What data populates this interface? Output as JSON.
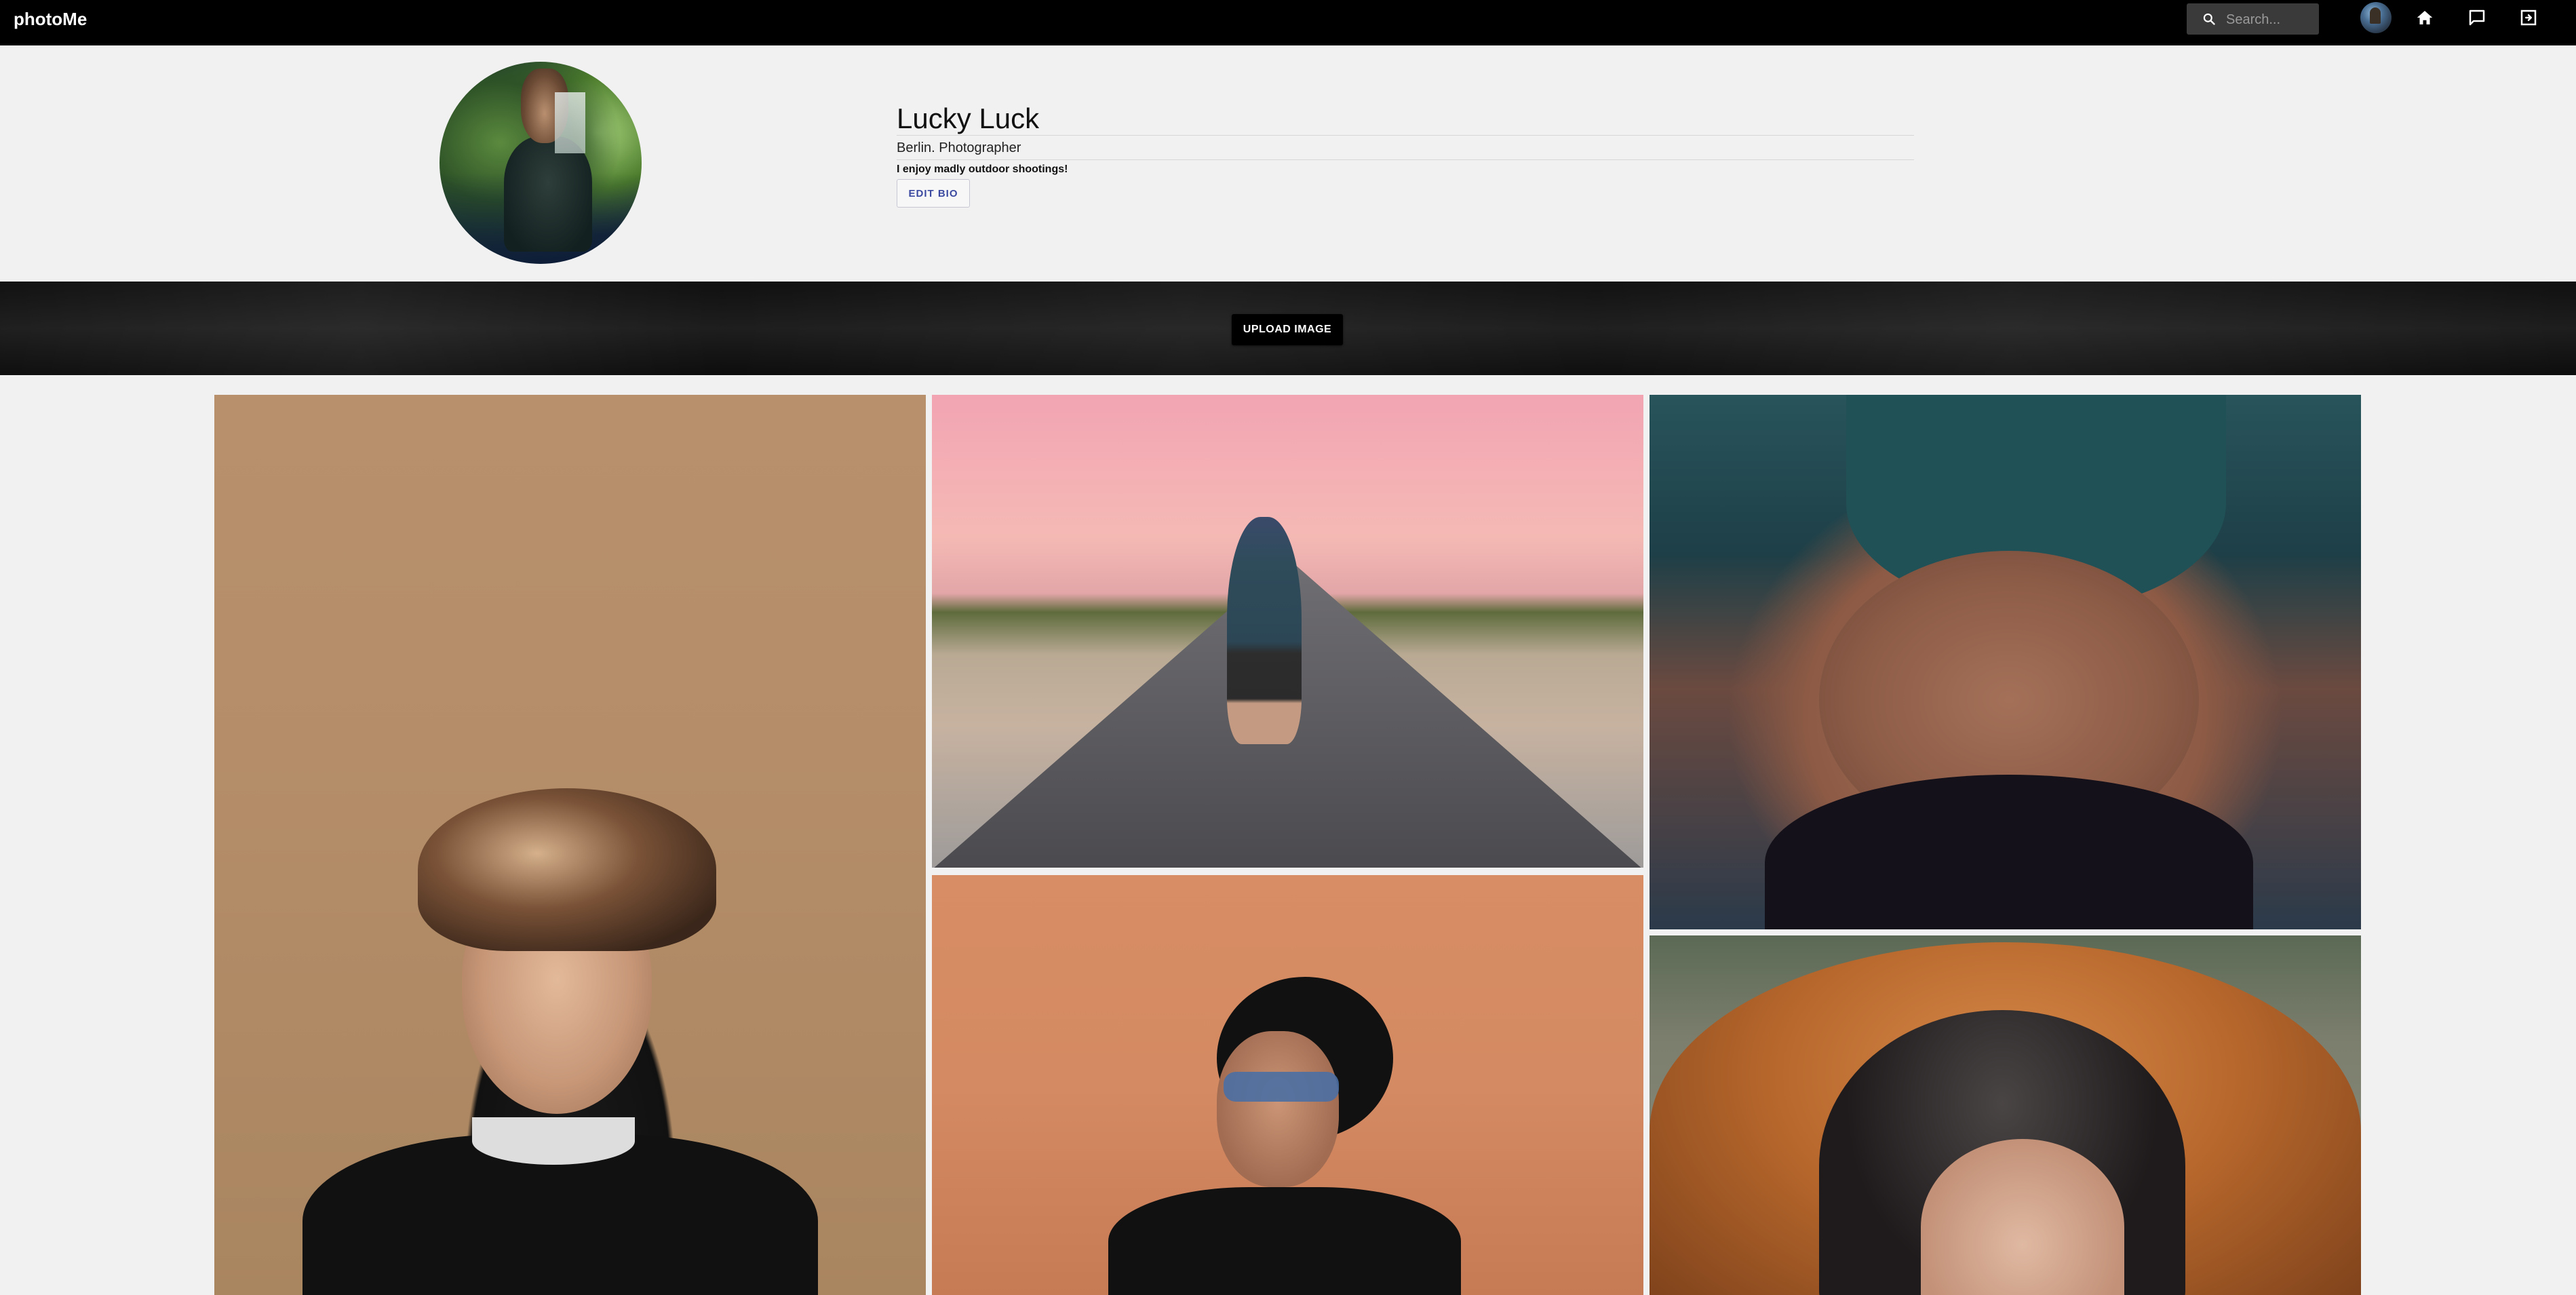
{
  "app": {
    "brand": "photoMe"
  },
  "header": {
    "search": {
      "placeholder": "Search..."
    }
  },
  "profile": {
    "name": "Lucky Luck",
    "subtitle": "Berlin. Photographer",
    "bio": "I enjoy madly outdoor shootings!",
    "edit_bio_label": "EDIT BIO"
  },
  "upload": {
    "label": "UPLOAD IMAGE"
  },
  "nav_icons": [
    "search-icon",
    "avatar",
    "home-icon",
    "chat-icon",
    "logout-icon"
  ],
  "colors": {
    "topbar": "#000000",
    "page_bg": "#f1f1f1",
    "edit_bio_text": "#3b4aa0",
    "band": "#111111"
  }
}
